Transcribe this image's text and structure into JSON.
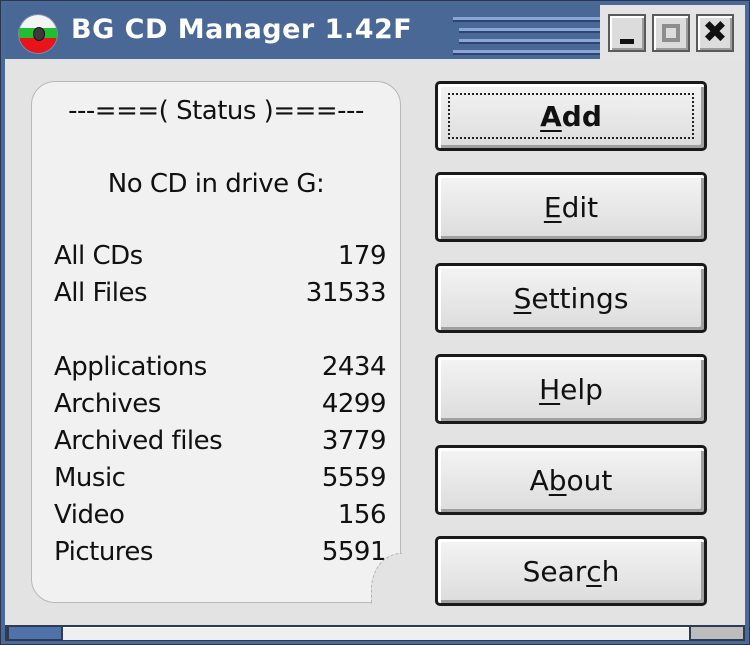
{
  "window": {
    "title": "BG CD Manager 1.42F",
    "icon": "bulgarian-flag-cd-icon",
    "controls": {
      "minimize": "minimize-icon",
      "maximize": "maximize-icon",
      "close": "close-icon",
      "close_glyph": "✖"
    }
  },
  "status": {
    "heading": "---===( Status )===---",
    "drive_message": "No CD in drive G:",
    "totals": [
      {
        "label": "All CDs",
        "value": "179"
      },
      {
        "label": "All Files",
        "value": "31533"
      }
    ],
    "categories": [
      {
        "label": "Applications",
        "value": "2434"
      },
      {
        "label": "Archives",
        "value": "4299"
      },
      {
        "label": "Archived files",
        "value": "3779"
      },
      {
        "label": "Music",
        "value": "5559"
      },
      {
        "label": "Video",
        "value": "156"
      },
      {
        "label": "Pictures",
        "value": "5591"
      }
    ]
  },
  "buttons": {
    "add": {
      "pre": "",
      "key": "A",
      "post": "dd"
    },
    "edit": {
      "pre": "",
      "key": "E",
      "post": "dit"
    },
    "settings": {
      "pre": "",
      "key": "S",
      "post": "ettings"
    },
    "help": {
      "pre": "",
      "key": "H",
      "post": "elp"
    },
    "about": {
      "pre": "A",
      "key": "b",
      "post": "out"
    },
    "search": {
      "pre": "Sear",
      "key": "c",
      "post": "h"
    }
  },
  "colors": {
    "titlebar": "#4a6896",
    "client_bg": "#e3e3e3",
    "panel_bg": "#f1f1f1"
  }
}
